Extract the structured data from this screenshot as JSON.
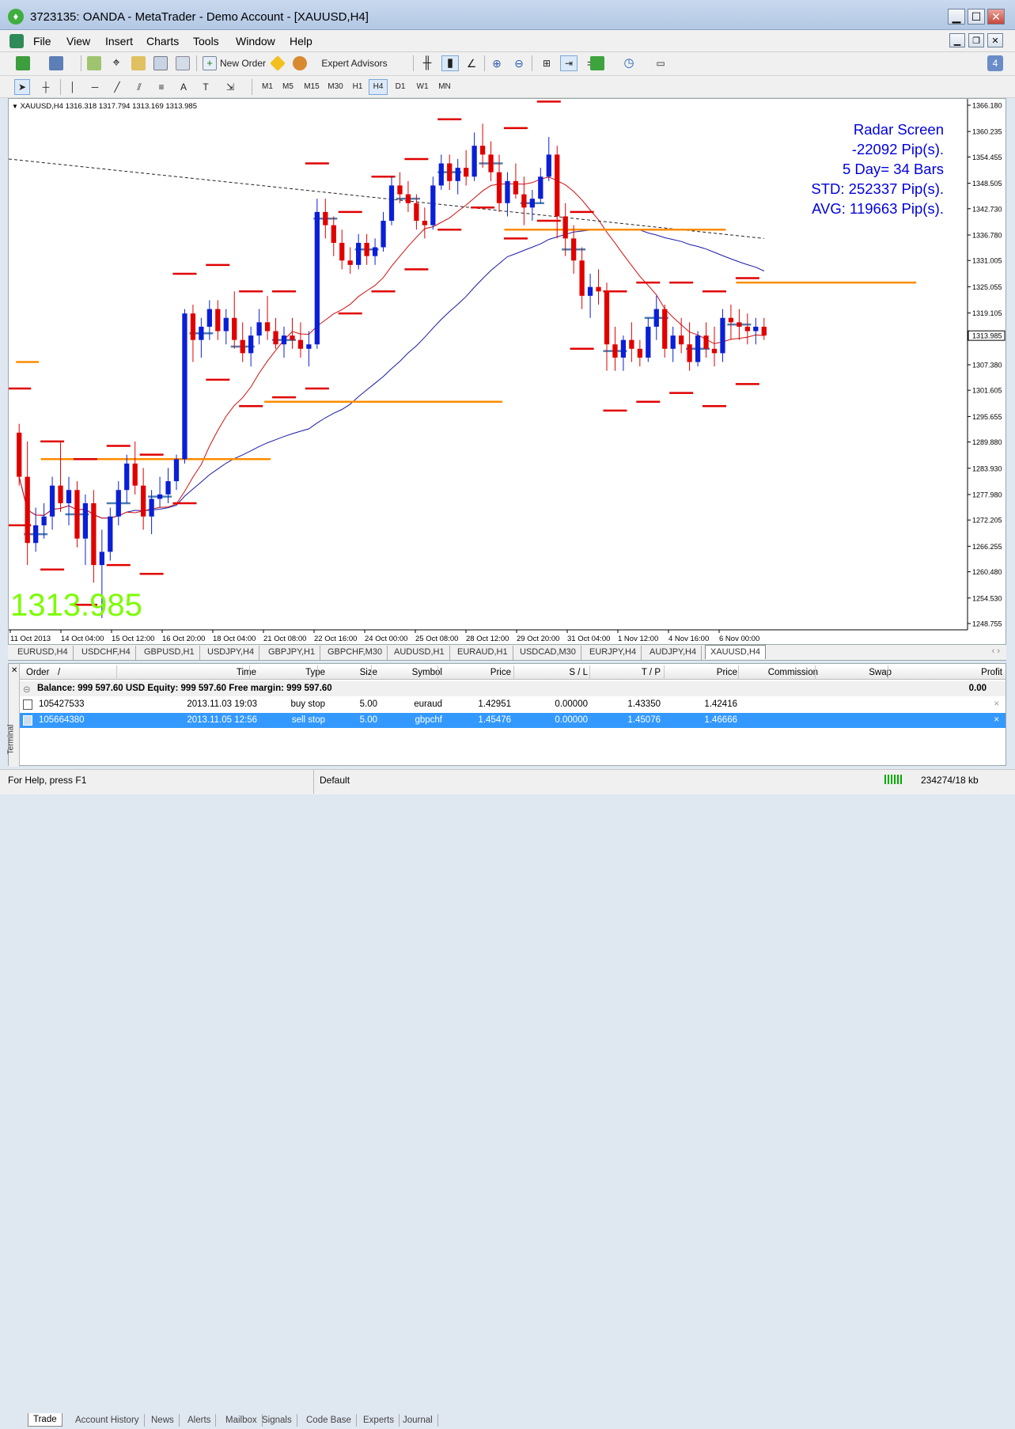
{
  "window": {
    "title": "3723135: OANDA - MetaTrader - Demo Account - [XAUUSD,H4]",
    "app_icon": "metatrader-logo-icon"
  },
  "menu": [
    "File",
    "View",
    "Insert",
    "Charts",
    "Tools",
    "Window",
    "Help"
  ],
  "toolbar": {
    "new_order": "New Order",
    "expert_advisors": "Expert Advisors",
    "timeframes": [
      "M1",
      "M5",
      "M15",
      "M30",
      "H1",
      "H4",
      "D1",
      "W1",
      "MN"
    ],
    "active_timeframe": "H4",
    "text_tool": "A"
  },
  "chart": {
    "header": "XAUUSD,H4  1316.318 1317.794 1313.169 1313.985",
    "big_price": "1313.985",
    "current_price_tag": "1313.985",
    "radar": [
      "Radar Screen",
      "-22092 Pip(s).",
      "5 Day= 34 Bars",
      "STD: 252337 Pip(s).",
      "AVG: 119663 Pip(s)."
    ],
    "colors": {
      "bull": "#0a1fd6",
      "bear": "#e00000",
      "ma_blue": "#1a1aa8",
      "ma_red": "#d01010",
      "orange": "#ff8c00",
      "steel": "#4a7fb0",
      "big_price": "#7cfc00",
      "radar": "#0000dd"
    }
  },
  "chart_data": {
    "type": "candlestick",
    "symbol": "XAUUSD",
    "timeframe": "H4",
    "ohlc_header": {
      "open": 1316.318,
      "high": 1317.794,
      "low": 1313.169,
      "close": 1313.985
    },
    "y_ticks": [
      "1366.180",
      "1360.235",
      "1354.455",
      "1348.505",
      "1342.730",
      "1336.780",
      "1331.005",
      "1325.055",
      "1319.105",
      "1313.985",
      "1307.380",
      "1301.605",
      "1295.655",
      "1289.880",
      "1283.930",
      "1277.980",
      "1272.205",
      "1266.255",
      "1260.480",
      "1254.530",
      "1248.755"
    ],
    "x_ticks": [
      "11 Oct 2013",
      "14 Oct 04:00",
      "15 Oct 12:00",
      "16 Oct 20:00",
      "18 Oct 04:00",
      "21 Oct 08:00",
      "22 Oct 16:00",
      "24 Oct 00:00",
      "25 Oct 08:00",
      "28 Oct 12:00",
      "29 Oct 20:00",
      "31 Oct 04:00",
      "1 Nov 12:00",
      "4 Nov 16:00",
      "6 Nov 00:00"
    ],
    "ylim": [
      1248.755,
      1366.18
    ],
    "candles": [
      [
        1292,
        1294,
        1280,
        1282
      ],
      [
        1282,
        1290,
        1262,
        1267
      ],
      [
        1267,
        1275,
        1265,
        1271
      ],
      [
        1271,
        1276,
        1268,
        1273
      ],
      [
        1273,
        1282,
        1270,
        1280
      ],
      [
        1280,
        1290,
        1274,
        1276
      ],
      [
        1276,
        1282,
        1271,
        1279
      ],
      [
        1279,
        1281,
        1266,
        1268
      ],
      [
        1268,
        1278,
        1262,
        1276
      ],
      [
        1276,
        1279,
        1258,
        1262
      ],
      [
        1262,
        1270,
        1250,
        1265
      ],
      [
        1265,
        1275,
        1263,
        1273
      ],
      [
        1273,
        1281,
        1271,
        1279
      ],
      [
        1279,
        1287,
        1276,
        1285
      ],
      [
        1285,
        1290,
        1278,
        1280
      ],
      [
        1280,
        1284,
        1270,
        1273
      ],
      [
        1273,
        1279,
        1269,
        1277
      ],
      [
        1277,
        1282,
        1275,
        1278
      ],
      [
        1278,
        1284,
        1276,
        1281
      ],
      [
        1281,
        1287,
        1279,
        1286
      ],
      [
        1286,
        1320,
        1285,
        1319
      ],
      [
        1319,
        1321,
        1308,
        1313
      ],
      [
        1313,
        1318,
        1309,
        1316
      ],
      [
        1316,
        1322,
        1313,
        1320
      ],
      [
        1320,
        1322,
        1313,
        1315
      ],
      [
        1315,
        1320,
        1312,
        1318
      ],
      [
        1318,
        1324,
        1311,
        1313
      ],
      [
        1313,
        1317,
        1308,
        1310
      ],
      [
        1310,
        1316,
        1307,
        1314
      ],
      [
        1314,
        1320,
        1312,
        1317
      ],
      [
        1317,
        1323,
        1313,
        1315
      ],
      [
        1315,
        1318,
        1311,
        1312
      ],
      [
        1312,
        1316,
        1309,
        1314
      ],
      [
        1314,
        1318,
        1311,
        1313
      ],
      [
        1313,
        1317,
        1309,
        1311
      ],
      [
        1311,
        1315,
        1307,
        1312
      ],
      [
        1312,
        1345,
        1311,
        1342
      ],
      [
        1342,
        1345,
        1336,
        1339
      ],
      [
        1339,
        1341,
        1332,
        1335
      ],
      [
        1335,
        1338,
        1329,
        1331
      ],
      [
        1331,
        1334,
        1328,
        1330
      ],
      [
        1330,
        1337,
        1329,
        1335
      ],
      [
        1335,
        1337,
        1330,
        1332
      ],
      [
        1332,
        1336,
        1330,
        1334
      ],
      [
        1334,
        1342,
        1333,
        1340
      ],
      [
        1340,
        1350,
        1339,
        1348
      ],
      [
        1348,
        1351,
        1344,
        1346
      ],
      [
        1346,
        1349,
        1342,
        1344
      ],
      [
        1344,
        1346,
        1338,
        1340
      ],
      [
        1340,
        1343,
        1336,
        1339
      ],
      [
        1339,
        1350,
        1338,
        1348
      ],
      [
        1348,
        1355,
        1347,
        1353
      ],
      [
        1353,
        1355,
        1347,
        1349
      ],
      [
        1349,
        1354,
        1346,
        1352
      ],
      [
        1352,
        1356,
        1348,
        1350
      ],
      [
        1350,
        1360,
        1349,
        1357
      ],
      [
        1357,
        1362,
        1352,
        1355
      ],
      [
        1355,
        1358,
        1349,
        1351
      ],
      [
        1351,
        1355,
        1342,
        1344
      ],
      [
        1344,
        1351,
        1341,
        1349
      ],
      [
        1349,
        1353,
        1345,
        1346
      ],
      [
        1346,
        1350,
        1339,
        1343
      ],
      [
        1343,
        1347,
        1340,
        1345
      ],
      [
        1345,
        1352,
        1344,
        1350
      ],
      [
        1350,
        1359,
        1349,
        1355
      ],
      [
        1355,
        1357,
        1336,
        1341
      ],
      [
        1341,
        1344,
        1332,
        1336
      ],
      [
        1336,
        1339,
        1328,
        1331
      ],
      [
        1331,
        1334,
        1320,
        1323
      ],
      [
        1323,
        1328,
        1318,
        1325
      ],
      [
        1325,
        1329,
        1321,
        1324
      ],
      [
        1324,
        1326,
        1306,
        1312
      ],
      [
        1312,
        1316,
        1306,
        1309
      ],
      [
        1309,
        1314,
        1306,
        1313
      ],
      [
        1313,
        1317,
        1308,
        1311
      ],
      [
        1311,
        1313,
        1307,
        1309
      ],
      [
        1309,
        1318,
        1308,
        1316
      ],
      [
        1316,
        1323,
        1313,
        1320
      ],
      [
        1320,
        1321,
        1309,
        1311
      ],
      [
        1311,
        1316,
        1308,
        1314
      ],
      [
        1314,
        1318,
        1310,
        1312
      ],
      [
        1312,
        1317,
        1306,
        1308
      ],
      [
        1308,
        1315,
        1307,
        1314
      ],
      [
        1314,
        1317,
        1309,
        1311
      ],
      [
        1311,
        1316,
        1307,
        1310
      ],
      [
        1310,
        1320,
        1308,
        1318
      ],
      [
        1318,
        1321,
        1313,
        1317
      ],
      [
        1317,
        1320,
        1313,
        1316
      ],
      [
        1316,
        1319,
        1312,
        1315
      ],
      [
        1315,
        1318,
        1312,
        1316
      ],
      [
        1316,
        1318,
        1313,
        1314
      ]
    ],
    "orange_levels": [
      {
        "y": 1286,
        "x0": 3,
        "x1": 30
      },
      {
        "y": 1308,
        "x0": 0,
        "x1": 2
      },
      {
        "y": 1299,
        "x0": 30,
        "x1": 58
      },
      {
        "y": 1338,
        "x0": 59,
        "x1": 85
      },
      {
        "y": 1326,
        "x0": 87,
        "x1": 108
      }
    ]
  },
  "symbol_tabs": [
    "EURUSD,H4",
    "USDCHF,H4",
    "GBPUSD,H1",
    "USDJPY,H4",
    "GBPJPY,H1",
    "GBPCHF,M30",
    "AUDUSD,H1",
    "EURAUD,H1",
    "USDCAD,M30",
    "EURJPY,H4",
    "AUDJPY,H4",
    "XAUUSD,H4"
  ],
  "active_symbol_tab": "XAUUSD,H4",
  "terminal": {
    "side_label": "Terminal",
    "columns": [
      "Order",
      "/",
      "Time",
      "Type",
      "Size",
      "Symbol",
      "Price",
      "S / L",
      "T / P",
      "Price",
      "Commission",
      "Swap",
      "Profit"
    ],
    "balance": "Balance: 999 597.60 USD  Equity: 999 597.60  Free margin: 999 597.60",
    "balance_profit": "0.00",
    "rows": [
      {
        "order": "105427533",
        "time": "2013.11.03 19:03",
        "type": "buy stop",
        "size": "5.00",
        "symbol": "euraud",
        "price": "1.42951",
        "sl": "0.00000",
        "tp": "1.43350",
        "cur_price": "1.42416"
      },
      {
        "order": "105664380",
        "time": "2013.11.05 12:56",
        "type": "sell stop",
        "size": "5.00",
        "symbol": "gbpchf",
        "price": "1.45476",
        "sl": "0.00000",
        "tp": "1.45076",
        "cur_price": "1.46666"
      }
    ]
  },
  "bottom_tabs": [
    "Trade",
    "Account History",
    "News",
    "Alerts",
    "Mailbox",
    "Signals",
    "Code Base",
    "Experts",
    "Journal"
  ],
  "active_bottom_tab": "Trade",
  "status": {
    "help": "For Help, press F1",
    "profile": "Default",
    "traffic": "234274/18 kb"
  }
}
